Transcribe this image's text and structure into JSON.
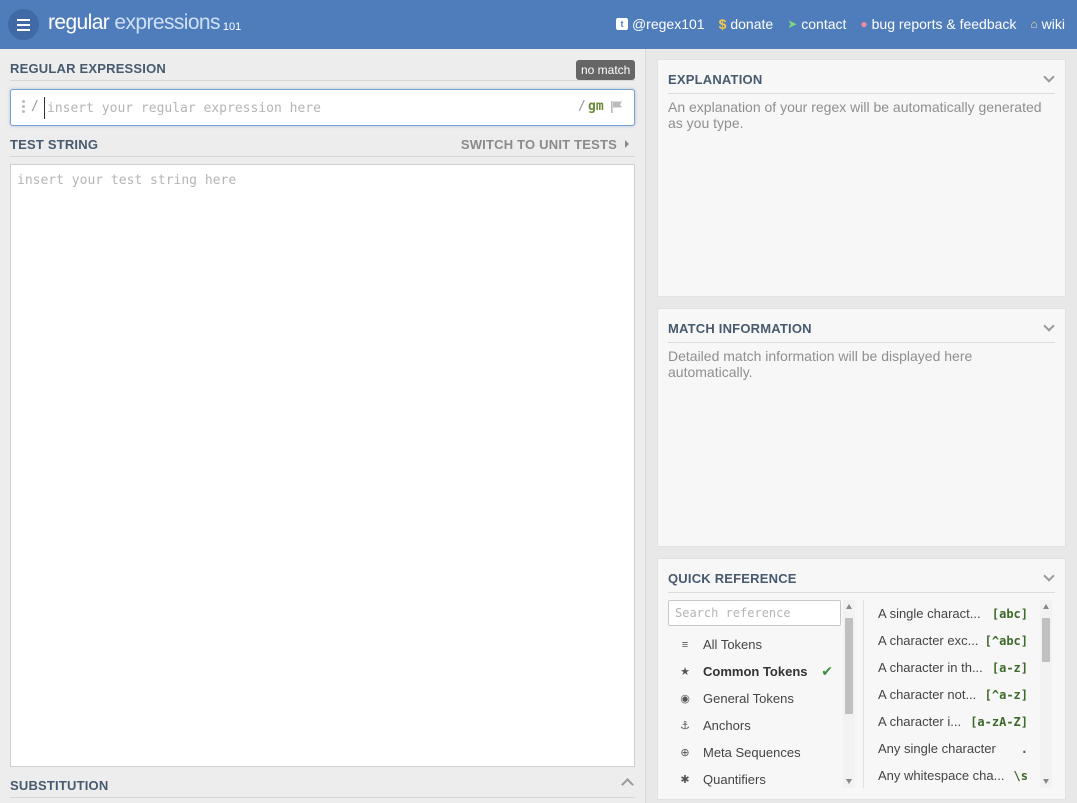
{
  "header": {
    "logo_main": "regular",
    "logo_light": "expressions",
    "logo_sup": "101",
    "nav": [
      {
        "label": "@regex101",
        "icon": "twitter-icon"
      },
      {
        "label": "donate",
        "icon": "dollar-icon"
      },
      {
        "label": "contact",
        "icon": "send-icon"
      },
      {
        "label": "bug reports & feedback",
        "icon": "bug-icon"
      },
      {
        "label": "wiki",
        "icon": "bank-icon"
      }
    ]
  },
  "regex": {
    "title": "REGULAR EXPRESSION",
    "status": "no match",
    "open_delim": "/",
    "close_delim": "/",
    "flags": "gm",
    "placeholder": "insert your regular expression here",
    "value": ""
  },
  "test": {
    "title": "TEST STRING",
    "switch_label": "SWITCH TO UNIT TESTS",
    "placeholder": "insert your test string here",
    "value": ""
  },
  "substitution": {
    "title": "SUBSTITUTION"
  },
  "explanation": {
    "title": "EXPLANATION",
    "text": "An explanation of your regex will be automatically generated as you type."
  },
  "match_info": {
    "title": "MATCH INFORMATION",
    "text": "Detailed match information will be displayed here automatically."
  },
  "quick_ref": {
    "title": "QUICK REFERENCE",
    "search_placeholder": "Search reference",
    "categories": [
      {
        "label": "All Tokens",
        "icon": "database-icon",
        "glyph": "≡"
      },
      {
        "label": "Common Tokens",
        "icon": "star-icon",
        "glyph": "★",
        "active": true
      },
      {
        "label": "General Tokens",
        "icon": "target-icon",
        "glyph": "◉"
      },
      {
        "label": "Anchors",
        "icon": "anchor-icon",
        "glyph": "⚓"
      },
      {
        "label": "Meta Sequences",
        "icon": "lifebuoy-icon",
        "glyph": "⊕"
      },
      {
        "label": "Quantifiers",
        "icon": "asterisk-icon",
        "glyph": "✱"
      }
    ],
    "items": [
      {
        "desc": "A single charact...",
        "token": "[abc]"
      },
      {
        "desc": "A character exc...",
        "token": "[^abc]"
      },
      {
        "desc": "A character in th...",
        "token": "[a-z]"
      },
      {
        "desc": "A character not...",
        "token": "[^a-z]"
      },
      {
        "desc": "A character i...",
        "token": "[a-zA-Z]"
      },
      {
        "desc": "Any single character",
        "token": "."
      },
      {
        "desc": "Any whitespace cha...",
        "token": "\\s"
      }
    ]
  },
  "colors": {
    "header": "#4f7dbb",
    "flag": "#6a8a3a",
    "token": "#3d6a2a",
    "check": "#3f8f3f"
  }
}
